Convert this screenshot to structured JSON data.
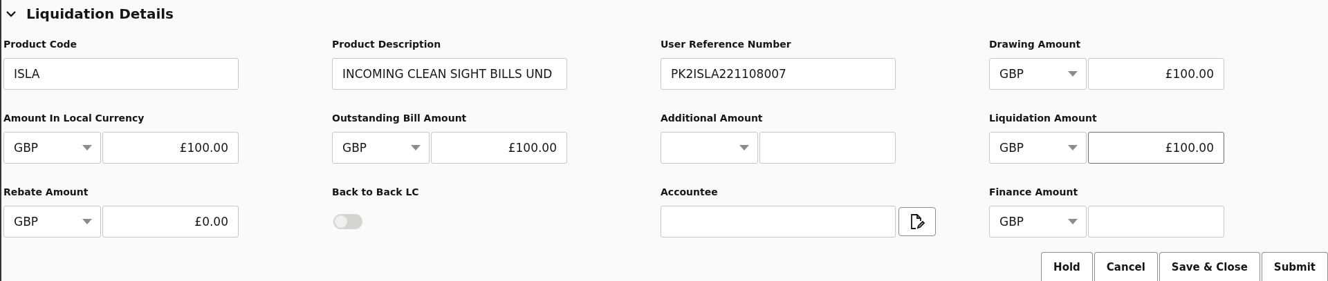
{
  "section": {
    "title": "Liquidation Details",
    "expanded": true
  },
  "fields": [
    {
      "kind": "text",
      "label": "Product Code",
      "value": "ISLA"
    },
    {
      "kind": "text",
      "label": "Product Description",
      "value": "INCOMING CLEAN SIGHT BILLS UND"
    },
    {
      "kind": "text",
      "label": "User Reference Number",
      "value": "PK2ISLA221108007"
    },
    {
      "kind": "currency",
      "label": "Drawing Amount",
      "currency": "GBP",
      "value": "£100.00",
      "focused": false
    },
    {
      "kind": "currency",
      "label": "Amount In Local Currency",
      "currency": "GBP",
      "value": "£100.00",
      "focused": false
    },
    {
      "kind": "currency",
      "label": "Outstanding Bill Amount",
      "currency": "GBP",
      "value": "£100.00",
      "focused": false
    },
    {
      "kind": "currency",
      "label": "Additional Amount",
      "focused": false
    },
    {
      "kind": "currency",
      "label": "Liquidation Amount",
      "currency": "GBP",
      "value": "£100.00",
      "focused": true
    },
    {
      "kind": "currency",
      "label": "Rebate Amount",
      "currency": "GBP",
      "value": "£0.00",
      "focused": false
    },
    {
      "kind": "toggle",
      "label": "Back to Back LC",
      "on": false
    },
    {
      "kind": "lookup",
      "label": "Accountee"
    },
    {
      "kind": "currency",
      "label": "Finance Amount",
      "currency": "GBP",
      "focused": false
    }
  ],
  "buttons": [
    "Hold",
    "Cancel",
    "Save & Close",
    "Submit"
  ]
}
